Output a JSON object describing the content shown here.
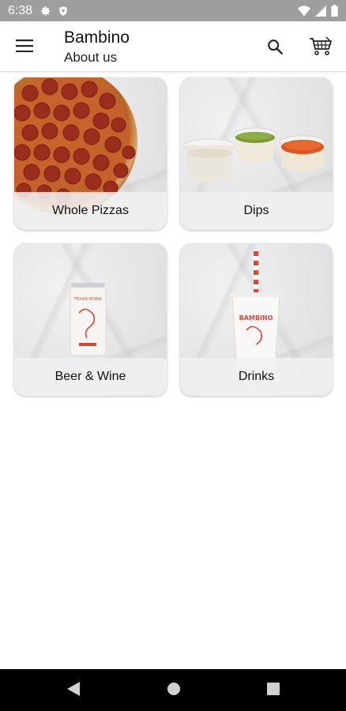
{
  "status_bar": {
    "time": "6:38"
  },
  "app_bar": {
    "title": "Bambino",
    "subtitle": "About us"
  },
  "categories": [
    {
      "label": "Whole Pizzas"
    },
    {
      "label": "Dips"
    },
    {
      "label": "Beer & Wine"
    },
    {
      "label": "Drinks"
    }
  ],
  "product_text": {
    "can_brand": "TEXAS BORN",
    "cup_brand": "BAMBINO"
  },
  "colors": {
    "status_bar_bg": "#9e9e9e",
    "nav_bar_bg": "#000000",
    "accent_red": "#d64a3b"
  },
  "icons": [
    "gear-icon",
    "shield-icon",
    "wifi-icon",
    "signal-icon",
    "battery-icon",
    "menu-icon",
    "search-icon",
    "cart-icon",
    "back-icon",
    "home-icon",
    "recents-icon"
  ]
}
